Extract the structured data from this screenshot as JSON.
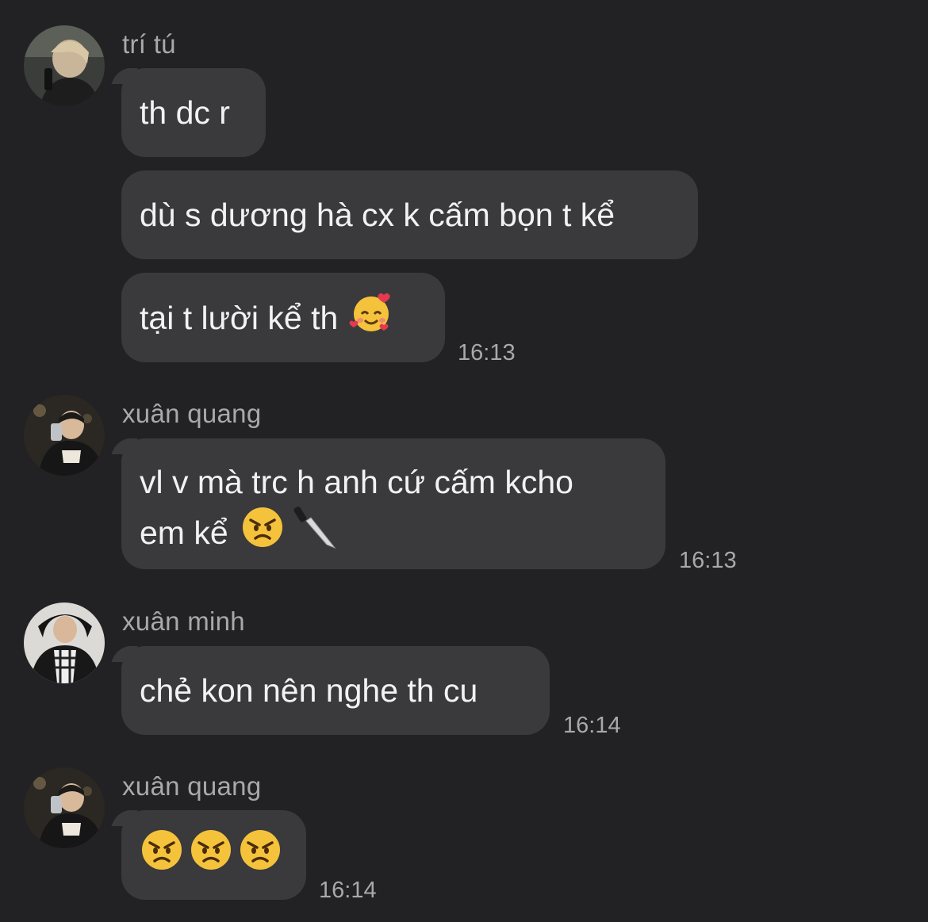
{
  "groups": [
    {
      "sender": "trí tú",
      "messages": [
        {
          "text": "th dc r"
        },
        {
          "text": "dù s dương hà cx k cấm bọn t kể"
        },
        {
          "text": "tại t lười kể th",
          "emoji": "smiling-face-with-hearts-emoji"
        }
      ],
      "time": "16:13"
    },
    {
      "sender": "xuân quang",
      "messages": [
        {
          "line1": "vl v mà trc h anh cứ cấm kcho",
          "line2": "em kể",
          "emoji": [
            "angry-face-emoji",
            "knife-emoji"
          ]
        }
      ],
      "time": "16:13"
    },
    {
      "sender": "xuân minh",
      "messages": [
        {
          "text": "chẻ kon nên nghe th cu"
        }
      ],
      "time": "16:14"
    },
    {
      "sender": "xuân quang",
      "messages": [
        {
          "emoji": [
            "angry-face-emoji",
            "angry-face-emoji",
            "angry-face-emoji"
          ]
        }
      ],
      "time": "16:14"
    }
  ],
  "colors": {
    "background": "#222224",
    "bubble": "#3a3a3c",
    "meta_text": "#a8a8ad",
    "message_text": "#f2f2f4"
  }
}
